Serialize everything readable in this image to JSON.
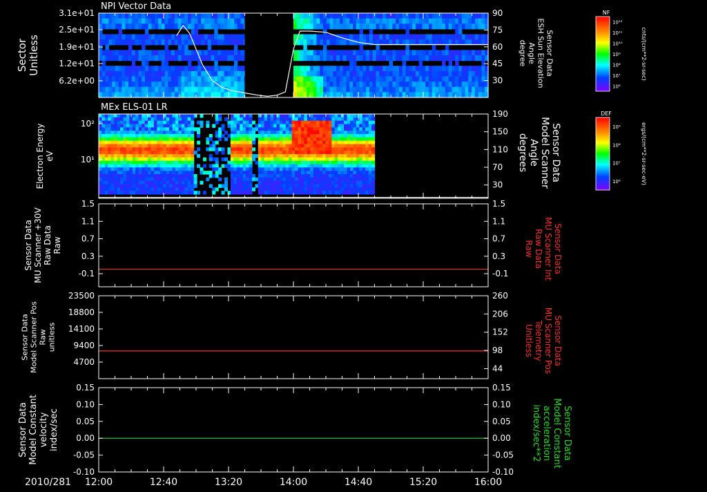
{
  "chart_data": [
    {
      "type": "heatmap",
      "title": "NPI Vector Data",
      "ylabel_left": [
        "Sector",
        "Unitless"
      ],
      "left_ticks": [
        "3.1e+01",
        "2.5e+01",
        "1.9e+01",
        "1.2e+01",
        "6.2e+00"
      ],
      "ylabel_right": [
        "Sensor Data",
        "ESH Sun Elevation",
        "Angle",
        "degree"
      ],
      "right_ticks": [
        "90",
        "75",
        "60",
        "45",
        "30"
      ],
      "ylim_right": [
        15,
        90
      ],
      "line_color": "#ffffff",
      "line": {
        "x": [
          "12:00",
          "12:40",
          "12:48",
          "12:52",
          "12:56",
          "13:00",
          "13:04",
          "13:10",
          "13:16",
          "13:22",
          "13:30",
          "13:38",
          "13:44",
          "13:50",
          "13:55",
          "14:00",
          "14:04",
          "14:10",
          "14:20",
          "14:30",
          "14:40",
          "14:50",
          "15:00",
          "15:20",
          "15:40",
          "16:00"
        ],
        "y": [
          null,
          null,
          70,
          79,
          72,
          58,
          44,
          30,
          24,
          21,
          19,
          17,
          16,
          17,
          20,
          58,
          74,
          74,
          73,
          68,
          64,
          62,
          62,
          62,
          62,
          62
        ]
      },
      "colorbar": {
        "label": "NF",
        "units": "cnts/(cm**2-sr-sec)",
        "ticks": [
          "10¹²",
          "10¹¹",
          "10¹⁰",
          "10⁹",
          "10⁸",
          "10⁷",
          "10⁶"
        ]
      }
    },
    {
      "type": "heatmap",
      "title": "MEx ELS-01 LR",
      "ylabel_left": [
        "Electron Energy",
        "eV"
      ],
      "left_ticks": [
        "10²",
        "10¹"
      ],
      "ylabel_right": [
        "Sensor Data",
        "Model Scanner",
        "Angle",
        "degrees"
      ],
      "right_ticks": [
        "190",
        "150",
        "110",
        "70",
        "30"
      ],
      "ylim_right": [
        0,
        190
      ],
      "line_color": "#ffffff",
      "line": {
        "x": [
          "12:00",
          "16:00"
        ],
        "y": [
          2,
          2
        ]
      },
      "colorbar": {
        "label": "DEF",
        "units": "ergs/(cm**2-sr-sec-eV)",
        "ticks": [
          "10⁹",
          "10⁸",
          "10⁷",
          "10⁶"
        ]
      }
    },
    {
      "type": "line",
      "ylabel_left": [
        "Sensor Data",
        "MU Scanner +30V",
        "Raw Data",
        "Raw"
      ],
      "left_ticks": [
        "1.5",
        "1.1",
        "0.7",
        "0.3",
        "-0.1"
      ],
      "ylim_left": [
        -0.4,
        1.5
      ],
      "ylabel_right": [
        "Sensor Data",
        "MU Scanner Int",
        "Raw Data",
        "Raw"
      ],
      "right_ticks": [
        "1.5",
        "1.1",
        "0.7",
        "0.3",
        "-0.1"
      ],
      "series_color": "#ff2a2a",
      "series": [
        {
          "x": [
            "12:00",
            "16:00"
          ],
          "values": [
            0.0,
            0.0
          ]
        }
      ]
    },
    {
      "type": "line",
      "ylabel_left": [
        "Sensor Data",
        "Model Scanner Pos",
        "Raw",
        "unitless"
      ],
      "left_ticks": [
        "23500",
        "18800",
        "14100",
        "9400",
        "4700"
      ],
      "ylim_left": [
        0,
        23500
      ],
      "ylabel_right": [
        "Sensor Data",
        "MU Scanner Pos",
        "Telemetry",
        "Unitless"
      ],
      "right_ticks": [
        "260",
        "206",
        "152",
        "98",
        "44"
      ],
      "series_color": "#ff2a2a",
      "series": [
        {
          "x": [
            "12:00",
            "16:00"
          ],
          "values": [
            7850,
            7850
          ]
        }
      ]
    },
    {
      "type": "line",
      "ylabel_left": [
        "Sensor Data",
        "Model Constant",
        "velocity",
        "index/sec"
      ],
      "left_ticks": [
        "0.15",
        "0.10",
        "0.05",
        "0.00",
        "-0.05",
        "-0.10"
      ],
      "ylim_left": [
        -0.1,
        0.15
      ],
      "ylabel_right": [
        "Sensor Data",
        "Model Constant",
        "acceleration",
        "index/sec**2"
      ],
      "right_ticks": [
        "0.15",
        "0.10",
        "0.05",
        "0.00",
        "-0.05",
        "-0.10"
      ],
      "series_color": "#22dd22",
      "series": [
        {
          "x": [
            "12:00",
            "16:00"
          ],
          "values": [
            0.0,
            0.0
          ]
        }
      ]
    }
  ],
  "time_axis": {
    "date_label": "2010/281",
    "ticks": [
      "12:00",
      "12:40",
      "13:20",
      "14:00",
      "14:40",
      "15:20",
      "16:00"
    ]
  },
  "colors": {
    "background": "#000000",
    "axis": "#ffffff",
    "right_red": "#ff2a2a",
    "right_green": "#22dd22"
  }
}
